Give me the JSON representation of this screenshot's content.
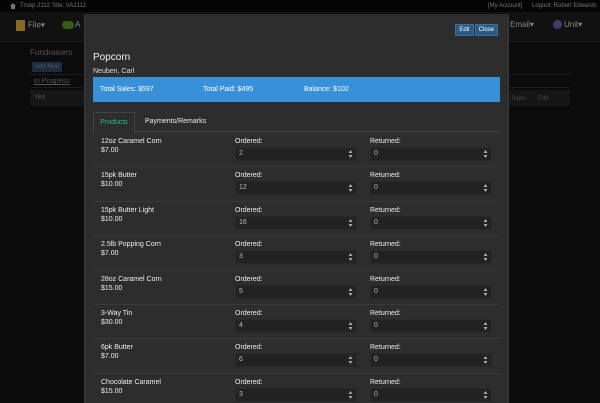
{
  "topbar": {
    "troop": "Troop 2112",
    "site": "Site: VA2112",
    "account": "[My Account]",
    "logout": "Logout: Robert Edwards"
  },
  "nav": {
    "file": "File",
    "a": "A",
    "email": "Email",
    "unit": "Unit"
  },
  "background": {
    "fundraisers": "Fundraisers",
    "add_new": "Add New",
    "in_progress": "In Progress",
    "yes": "Yes",
    "sales": "t Sales",
    "edit": "Edit"
  },
  "modal": {
    "edit_label": "Edit",
    "close_label": "Close",
    "title": "Popcorn",
    "member": "Neuben, Carl",
    "summary": {
      "total_sales": "Total Sales: $597",
      "total_paid": "Total Paid: $495",
      "balance": "Balance: $102"
    },
    "tabs": {
      "products": "Products",
      "payments": "Payments/Remarks"
    },
    "ordered_label": "Ordered:",
    "returned_label": "Returned:",
    "products": [
      {
        "name": "12oz Caramel Corn",
        "price": "$7.00",
        "ordered": "2",
        "returned": "0"
      },
      {
        "name": "15pk Butter",
        "price": "$10.00",
        "ordered": "12",
        "returned": "0"
      },
      {
        "name": "15pk Butter Light",
        "price": "$10.00",
        "ordered": "16",
        "returned": "0"
      },
      {
        "name": "2.5lb Popping Corn",
        "price": "$7.00",
        "ordered": "3",
        "returned": "0"
      },
      {
        "name": "28oz Caramel Corn",
        "price": "$15.00",
        "ordered": "5",
        "returned": "0"
      },
      {
        "name": "3-Way Tin",
        "price": "$30.00",
        "ordered": "4",
        "returned": "0"
      },
      {
        "name": "6pk Butter",
        "price": "$7.00",
        "ordered": "6",
        "returned": "0"
      },
      {
        "name": "Chocolate Caramel",
        "price": "$15.00",
        "ordered": "3",
        "returned": "0"
      }
    ]
  },
  "colors": {
    "summary_bar": "#3891d8",
    "active_tab": "#2dbb90",
    "button": "#2a5a86"
  }
}
